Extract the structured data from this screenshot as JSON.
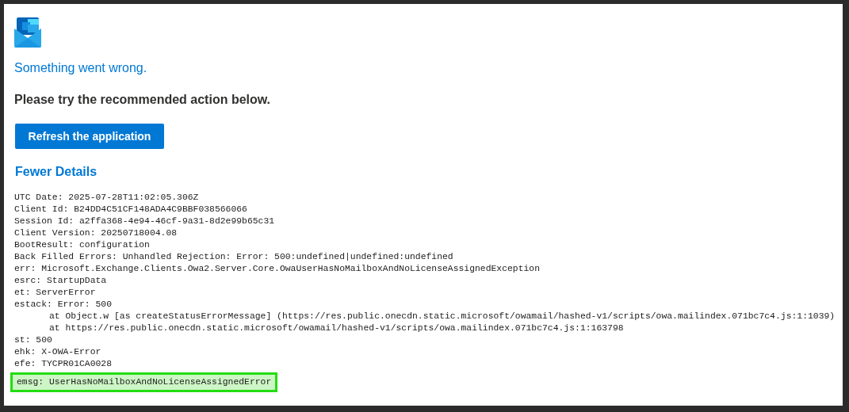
{
  "error_title": "Something went wrong.",
  "instruction": "Please try the recommended action below.",
  "refresh_button": "Refresh the application",
  "details_toggle": "Fewer Details",
  "details": [
    {
      "kind": "line",
      "text": "UTC Date: 2025-07-28T11:02:05.306Z",
      "highlighted": false
    },
    {
      "kind": "line",
      "text": "Client Id: B24DD4C51CF148ADA4C9BBF038566066",
      "highlighted": false
    },
    {
      "kind": "line",
      "text": "Session Id: a2ffa368-4e94-46cf-9a31-8d2e99b65c31",
      "highlighted": false
    },
    {
      "kind": "line",
      "text": "Client Version: 20250718004.08",
      "highlighted": false
    },
    {
      "kind": "line",
      "text": "BootResult: configuration",
      "highlighted": false
    },
    {
      "kind": "line",
      "text": "Back Filled Errors: Unhandled Rejection: Error: 500:undefined|undefined:undefined",
      "highlighted": false
    },
    {
      "kind": "line",
      "text": "err: Microsoft.Exchange.Clients.Owa2.Server.Core.OwaUserHasNoMailboxAndNoLicenseAssignedException",
      "highlighted": false
    },
    {
      "kind": "line",
      "text": "esrc: StartupData",
      "highlighted": false
    },
    {
      "kind": "line",
      "text": "et: ServerError",
      "highlighted": false
    },
    {
      "kind": "line",
      "text": "estack: Error: 500",
      "highlighted": false
    },
    {
      "kind": "stack",
      "text": "at Object.w [as createStatusErrorMessage] (https://res.public.onecdn.static.microsoft/owamail/hashed-v1/scripts/owa.mailindex.071bc7c4.js:1:1039)",
      "highlighted": false
    },
    {
      "kind": "stack",
      "text": "at https://res.public.onecdn.static.microsoft/owamail/hashed-v1/scripts/owa.mailindex.071bc7c4.js:1:163798",
      "highlighted": false
    },
    {
      "kind": "line",
      "text": "st: 500",
      "highlighted": false
    },
    {
      "kind": "line",
      "text": "ehk: X-OWA-Error",
      "highlighted": false
    },
    {
      "kind": "line",
      "text": "efe: TYCPR01CA0028",
      "highlighted": false
    },
    {
      "kind": "line",
      "text": "emsg: UserHasNoMailboxAndNoLicenseAssignedError",
      "highlighted": true
    }
  ]
}
